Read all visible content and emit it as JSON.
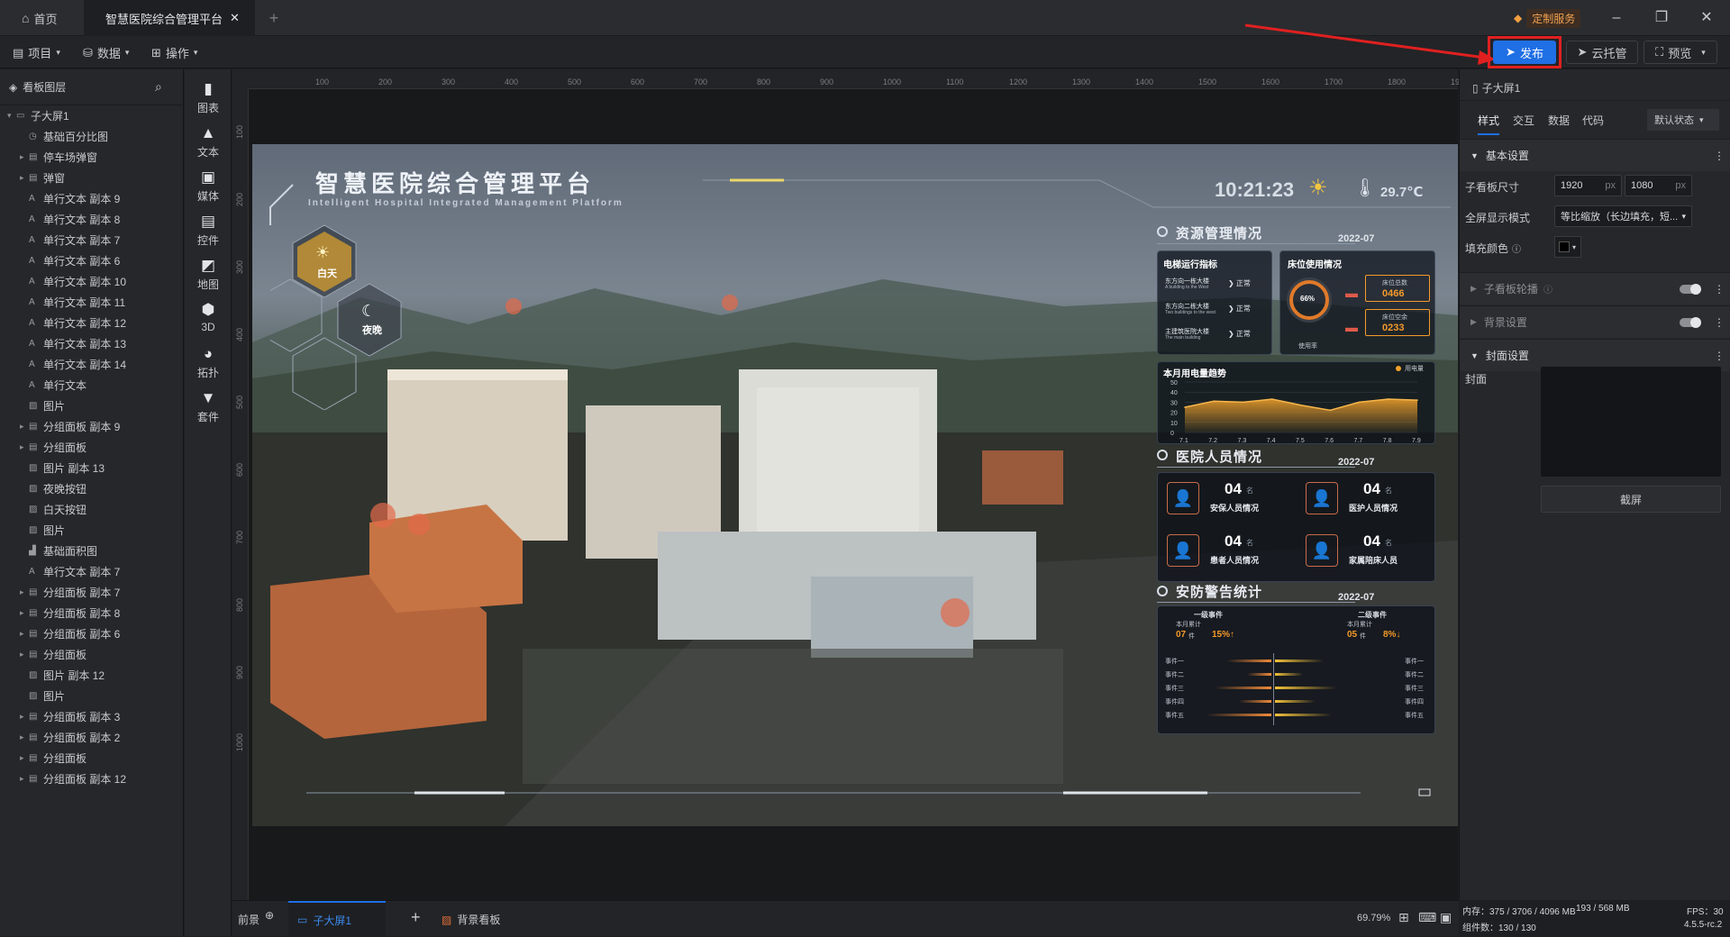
{
  "titlebar": {
    "home_tab": "首页",
    "doc_tab": "智慧医院综合管理平台",
    "custom_service": "定制服务"
  },
  "menubar": {
    "menus": [
      "项目",
      "数据",
      "操作"
    ],
    "publish": "发布",
    "cloud_host": "云托管",
    "preview": "预览"
  },
  "layers": {
    "title": "看板图层",
    "items": [
      {
        "label": "子大屏1",
        "caret": "▾",
        "icon": "screen"
      },
      {
        "label": "基础百分比图",
        "caret": "",
        "icon": "pct"
      },
      {
        "label": "停车场弹窗",
        "caret": "▸",
        "icon": "group"
      },
      {
        "label": "弹窗",
        "caret": "▸",
        "icon": "group"
      },
      {
        "label": "单行文本 副本 9",
        "caret": "",
        "icon": "text"
      },
      {
        "label": "单行文本 副本 8",
        "caret": "",
        "icon": "text"
      },
      {
        "label": "单行文本 副本 7",
        "caret": "",
        "icon": "text"
      },
      {
        "label": "单行文本 副本 6",
        "caret": "",
        "icon": "text"
      },
      {
        "label": "单行文本 副本 10",
        "caret": "",
        "icon": "text"
      },
      {
        "label": "单行文本 副本 11",
        "caret": "",
        "icon": "text"
      },
      {
        "label": "单行文本 副本 12",
        "caret": "",
        "icon": "text"
      },
      {
        "label": "单行文本 副本 13",
        "caret": "",
        "icon": "text"
      },
      {
        "label": "单行文本 副本 14",
        "caret": "",
        "icon": "text"
      },
      {
        "label": "单行文本",
        "caret": "",
        "icon": "text"
      },
      {
        "label": "图片",
        "caret": "",
        "icon": "image"
      },
      {
        "label": "分组面板 副本 9",
        "caret": "▸",
        "icon": "group"
      },
      {
        "label": "分组面板",
        "caret": "▸",
        "icon": "group"
      },
      {
        "label": "图片 副本 13",
        "caret": "",
        "icon": "image"
      },
      {
        "label": "夜晚按钮",
        "caret": "",
        "icon": "image"
      },
      {
        "label": "白天按钮",
        "caret": "",
        "icon": "image"
      },
      {
        "label": "图片",
        "caret": "",
        "icon": "image"
      },
      {
        "label": "基础面积图",
        "caret": "",
        "icon": "chart"
      },
      {
        "label": "单行文本 副本 7",
        "caret": "",
        "icon": "text"
      },
      {
        "label": "分组面板 副本 7",
        "caret": "▸",
        "icon": "group"
      },
      {
        "label": "分组面板 副本 8",
        "caret": "▸",
        "icon": "group"
      },
      {
        "label": "分组面板 副本 6",
        "caret": "▸",
        "icon": "group"
      },
      {
        "label": "分组面板",
        "caret": "▸",
        "icon": "group"
      },
      {
        "label": "图片 副本 12",
        "caret": "",
        "icon": "image"
      },
      {
        "label": "图片",
        "caret": "",
        "icon": "image"
      },
      {
        "label": "分组面板 副本 3",
        "caret": "▸",
        "icon": "group"
      },
      {
        "label": "分组面板 副本 2",
        "caret": "▸",
        "icon": "group"
      },
      {
        "label": "分组面板",
        "caret": "▸",
        "icon": "group"
      },
      {
        "label": "分组面板 副本 12",
        "caret": "▸",
        "icon": "group"
      }
    ]
  },
  "tools": [
    {
      "label": "图表",
      "icon": "bar-chart-icon",
      "glyph": "▮"
    },
    {
      "label": "文本",
      "icon": "text-icon",
      "glyph": "▲"
    },
    {
      "label": "媒体",
      "icon": "media-icon",
      "glyph": "▣"
    },
    {
      "label": "控件",
      "icon": "widget-icon",
      "glyph": "▤"
    },
    {
      "label": "地图",
      "icon": "map-icon",
      "glyph": "◩"
    },
    {
      "label": "3D",
      "icon": "cube-icon",
      "glyph": "⬢"
    },
    {
      "label": "拓扑",
      "icon": "topology-icon",
      "glyph": "◕"
    },
    {
      "label": "套件",
      "icon": "kit-icon",
      "glyph": "▼"
    }
  ],
  "ruler": {
    "h_ticks": [
      "100",
      "200",
      "300",
      "400",
      "500",
      "600",
      "700",
      "800",
      "900",
      "1000",
      "1100",
      "1200",
      "1300",
      "1400",
      "1500",
      "1600",
      "1700",
      "1800",
      "1900"
    ],
    "v_ticks": [
      "100",
      "200",
      "300",
      "400",
      "500",
      "600",
      "700",
      "800",
      "900",
      "1000"
    ]
  },
  "dashboard": {
    "title": "智慧医院综合管理平台",
    "subtitle": "Intelligent Hospital Integrated Management Platform",
    "time": "10:21:23",
    "temperature": "29.7℃",
    "day_label": "白天",
    "night_label": "夜晚",
    "resource": {
      "title": "资源管理情况",
      "date": "2022-07",
      "elevator_title": "电梯运行指标",
      "elevators": [
        {
          "name": "东方向一栋大楼",
          "en": "A building to the West",
          "status": "正常"
        },
        {
          "name": "东方向二栋大楼",
          "en": "Two buildings to the west",
          "status": "正常"
        },
        {
          "name": "主建筑医院大楼",
          "en": "The main building",
          "status": "正常"
        }
      ],
      "bed_title": "床位使用情况",
      "usage_pct": "66%",
      "usage_label": "使用率",
      "bed_total_label": "床位总数",
      "bed_total": "0466",
      "bed_free_label": "床位空余",
      "bed_free": "0233"
    },
    "power": {
      "title": "本月用电量趋势",
      "legend": "用电量",
      "y_ticks": [
        "50",
        "40",
        "30",
        "20",
        "10",
        "0"
      ],
      "x_ticks": [
        "7.1",
        "7.2",
        "7.3",
        "7.4",
        "7.5",
        "7.6",
        "7.7",
        "7.8",
        "7.9"
      ]
    },
    "staff": {
      "title": "医院人员情况",
      "date": "2022-07",
      "items": [
        {
          "value": "04",
          "unit": "名",
          "label": "安保人员情况"
        },
        {
          "value": "04",
          "unit": "名",
          "label": "医护人员情况"
        },
        {
          "value": "04",
          "unit": "名",
          "label": "患者人员情况"
        },
        {
          "value": "04",
          "unit": "名",
          "label": "家属陪床人员"
        }
      ]
    },
    "security": {
      "title": "安防警告统计",
      "date": "2022-07",
      "level1": {
        "label": "一级事件",
        "sub": "本月累计",
        "count": "07",
        "unit": "件",
        "pct": "15%↑"
      },
      "level2": {
        "label": "二级事件",
        "sub": "本月累计",
        "count": "05",
        "unit": "件",
        "pct": "8%↓"
      },
      "events": [
        "事件一",
        "事件二",
        "事件三",
        "事件四",
        "事件五"
      ]
    }
  },
  "props": {
    "panel_title": "子大屏1",
    "tabs": [
      "样式",
      "交互",
      "数据",
      "代码"
    ],
    "state_select": "默认状态",
    "basic_section": "基本设置",
    "size_label": "子看板尺寸",
    "width": "1920",
    "height": "1080",
    "unit": "px",
    "fullscreen_label": "全屏显示模式",
    "fullscreen_value": "等比缩放（长边填充，短...",
    "fill_label": "填充颜色",
    "carousel_section": "子看板轮播",
    "bg_section": "背景设置",
    "cover_section": "封面设置",
    "cover_label": "封面",
    "screenshot_btn": "截屏"
  },
  "status": {
    "front": "前景",
    "current_screen": "子大屏1",
    "bg_board": "背景看板",
    "zoom": "69.79%",
    "memory": "内存：375 / 3706 / 4096 MB",
    "mem2": "193 / 568 MB",
    "fps": "FPS：30",
    "components": "组件数：130 / 130",
    "version": "4.5.5-rc.2"
  },
  "colors": {
    "accent": "#1f6fe5",
    "highlight_red": "#e02020",
    "orange": "#f49a2a"
  },
  "chart_data": {
    "type": "area",
    "title": "本月用电量趋势",
    "categories": [
      "7.1",
      "7.2",
      "7.3",
      "7.4",
      "7.5",
      "7.6",
      "7.7",
      "7.8",
      "7.9"
    ],
    "series": [
      {
        "name": "用电量",
        "values": [
          25,
          31,
          30,
          33,
          27,
          22,
          30,
          33,
          32
        ]
      }
    ],
    "ylim": [
      0,
      50
    ]
  }
}
